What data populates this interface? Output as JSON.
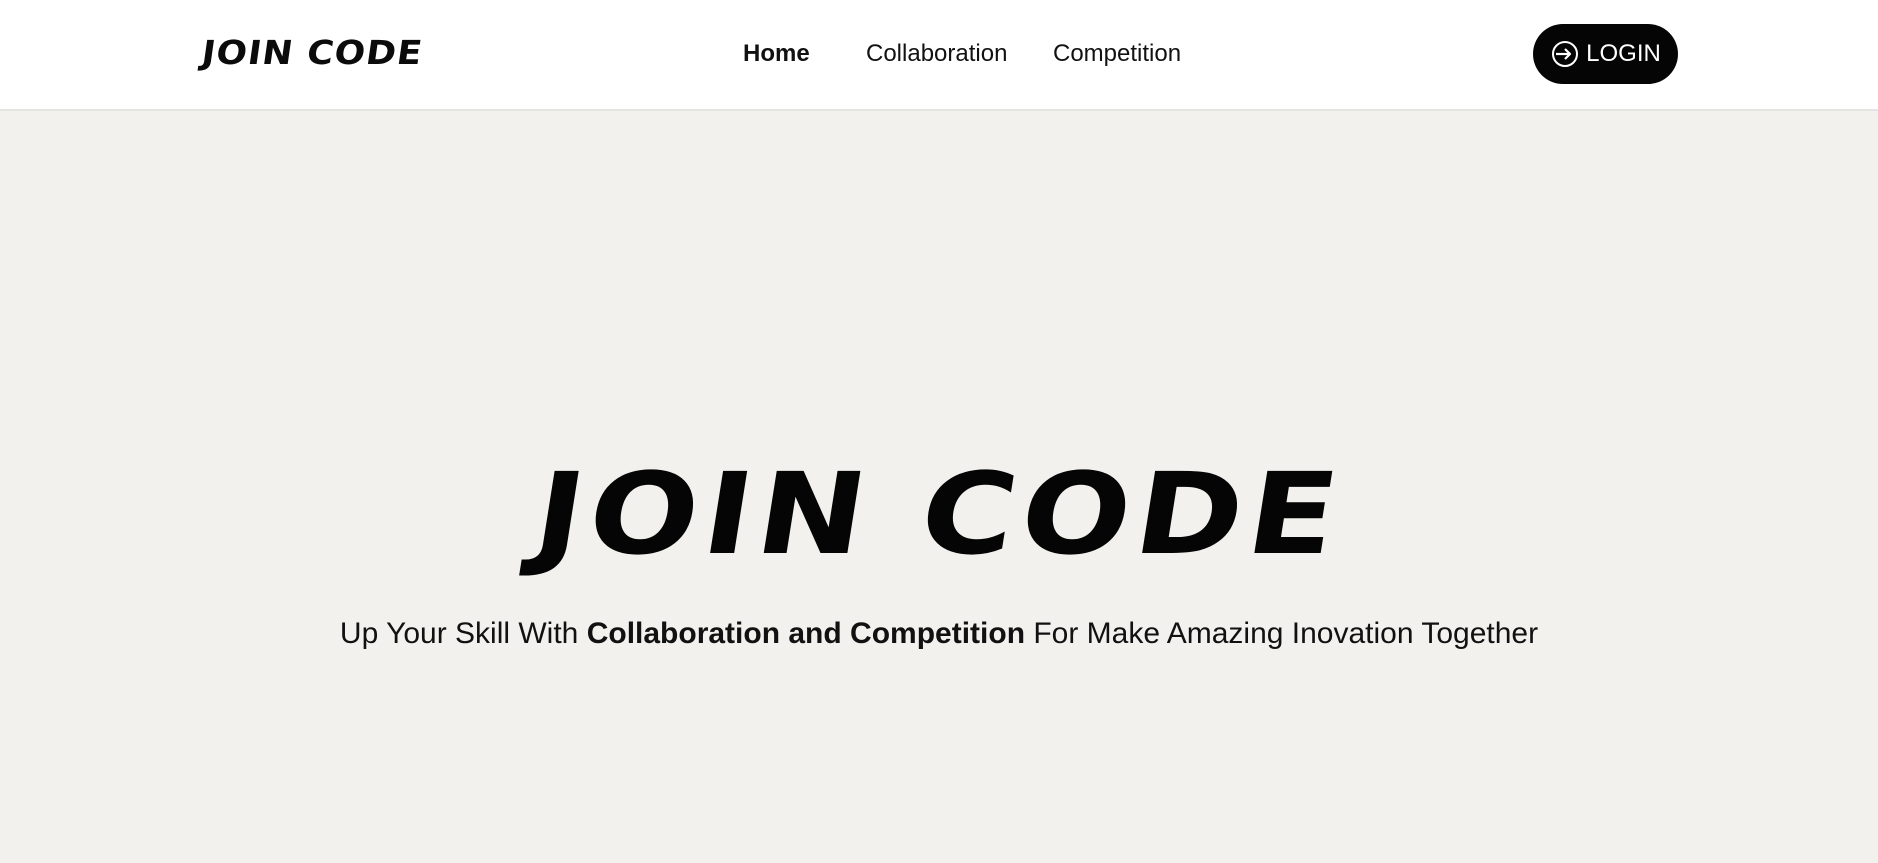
{
  "navbar": {
    "brand": "JOIN CODE",
    "links": {
      "home": "Home",
      "collaboration": "Collaboration",
      "competition": "Competition"
    },
    "login_label": "LOGIN",
    "login_icon": "login-arrow-icon"
  },
  "hero": {
    "title": "JOIN CODE",
    "subtitle": {
      "prefix": "Up Your Skill With ",
      "emphasis": "Collaboration and Competition",
      "suffix": " For Make Amazing Inovation Together"
    }
  },
  "colors": {
    "background": "#f2f1ee",
    "navbar": "#ffffff",
    "button": "#050505",
    "text": "#111111"
  }
}
